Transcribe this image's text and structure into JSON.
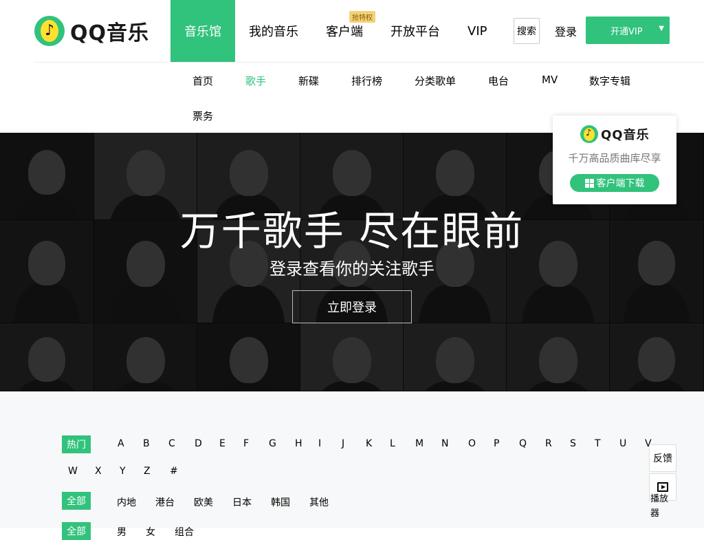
{
  "brand": {
    "logo_text": "QQ音乐",
    "logo_glyph": "♪",
    "accent": "#31c27c"
  },
  "main_nav": [
    {
      "label": "音乐馆",
      "active": true
    },
    {
      "label": "我的音乐",
      "active": false
    },
    {
      "label": "客户端",
      "active": false,
      "badge": "抢特权"
    },
    {
      "label": "开放平台",
      "active": false
    },
    {
      "label": "VIP",
      "active": false
    }
  ],
  "header": {
    "search_label": "搜索",
    "login_label": "登录",
    "vip_button": "开通VIP",
    "vip_arrow": "▼"
  },
  "sub_nav": [
    "首页",
    "歌手",
    "新碟",
    "排行榜",
    "分类歌单",
    "电台",
    "MV",
    "数字专辑",
    "票务"
  ],
  "sub_nav_active": "歌手",
  "banner": {
    "title": "万千歌手 尽在眼前",
    "subtitle": "登录查看你的关注歌手",
    "button": "立即登录"
  },
  "download_popup": {
    "logo_text": "QQ音乐",
    "tagline": "千万高品质曲库尽享",
    "button": "客户端下载"
  },
  "filters": {
    "index_tag": "热门",
    "letters": [
      "A",
      "B",
      "C",
      "D",
      "E",
      "F",
      "G",
      "H",
      "I",
      "J",
      "K",
      "L",
      "M",
      "N",
      "O",
      "P",
      "Q",
      "R",
      "S",
      "T",
      "U",
      "V",
      "W",
      "X",
      "Y",
      "Z",
      "#"
    ],
    "area_tag": "全部",
    "areas": [
      "内地",
      "港台",
      "欧美",
      "日本",
      "韩国",
      "其他"
    ],
    "sex_tag": "全部",
    "sexes": [
      "男",
      "女",
      "组合"
    ]
  },
  "side_tools": {
    "feedback": "反馈",
    "player": "播放器"
  }
}
